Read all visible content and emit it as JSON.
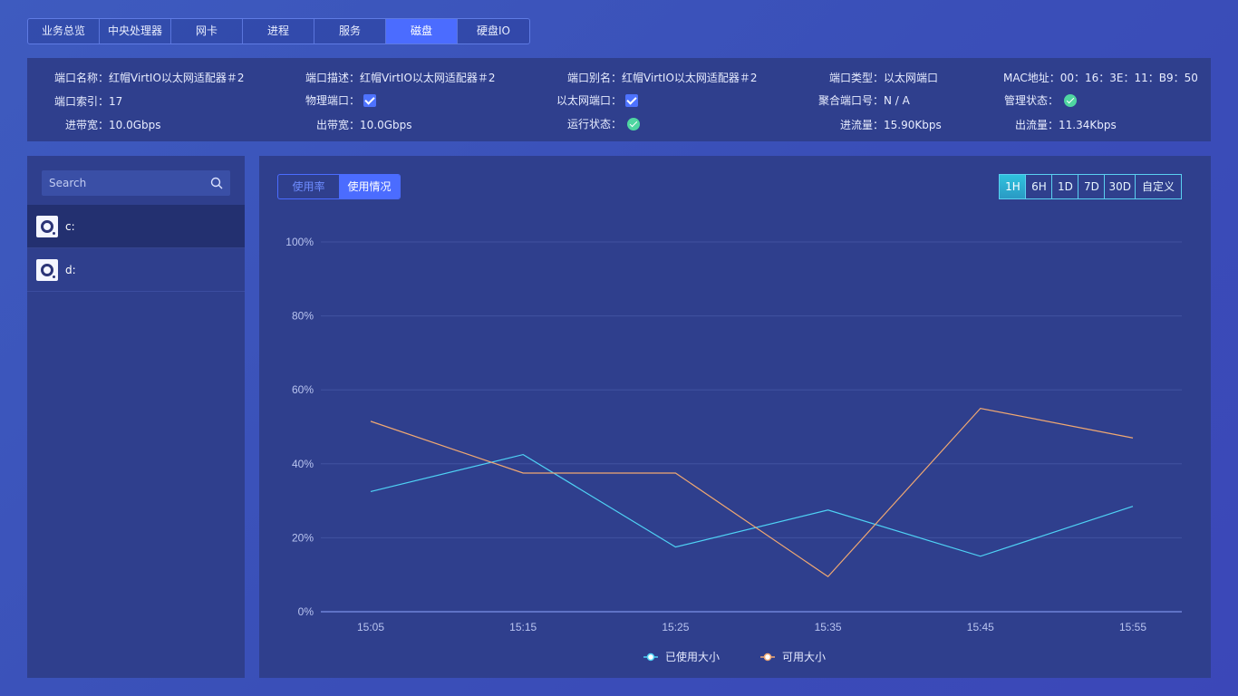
{
  "tabs": [
    {
      "label": "业务总览"
    },
    {
      "label": "中央处理器"
    },
    {
      "label": "网卡"
    },
    {
      "label": "进程"
    },
    {
      "label": "服务"
    },
    {
      "label": "磁盘"
    },
    {
      "label": "硬盘IO"
    }
  ],
  "active_tab": 5,
  "info": {
    "port_name": "端口名称：红帽VirtIO以太网适配器＃2",
    "port_desc": "端口描述：红帽VirtIO以太网适配器＃2",
    "port_alias": "端口别名：红帽VirtIO以太网适配器＃2",
    "port_type": "端口类型：以太网端口",
    "mac": "MAC地址：00：16：3E：11：B9：50",
    "port_index": "端口索引：17",
    "physical_port": "物理端口：",
    "ethernet_port": "以太网端口：",
    "agg_port": "聚合端口号：N / A",
    "admin_status": "管理状态：",
    "in_bw": "进带宽：10.0Gbps",
    "out_bw": "出带宽：10.0Gbps",
    "run_status": "运行状态：",
    "in_traffic": "进流量：15.90Kbps",
    "out_traffic": "出流量：11.34Kbps"
  },
  "search": {
    "placeholder": "Search"
  },
  "disks": [
    {
      "label": "c:"
    },
    {
      "label": "d:"
    }
  ],
  "toggle": [
    {
      "label": "使用率"
    },
    {
      "label": "使用情况"
    }
  ],
  "ranges": [
    {
      "label": "1H"
    },
    {
      "label": "6H"
    },
    {
      "label": "1D"
    },
    {
      "label": "7D"
    },
    {
      "label": "30D"
    },
    {
      "label": "自定义"
    }
  ],
  "colors": {
    "used": "#4fd2f5",
    "available": "#f0a872",
    "active_tab": "#4b6cff"
  },
  "chart_data": {
    "type": "line",
    "categories": [
      "15:05",
      "15:15",
      "15:25",
      "15:35",
      "15:45",
      "15:55"
    ],
    "ylim": [
      0,
      100
    ],
    "yticks": [
      "0%",
      "20%",
      "40%",
      "60%",
      "80%",
      "100%"
    ],
    "grid": true,
    "legend": "bottom-center",
    "series": [
      {
        "name": "已使用大小",
        "values": [
          32.5,
          42.5,
          17.5,
          27.5,
          15,
          28.5
        ]
      },
      {
        "name": "可用大小",
        "values": [
          51.5,
          37.5,
          37.5,
          9.5,
          55,
          47
        ]
      }
    ]
  }
}
